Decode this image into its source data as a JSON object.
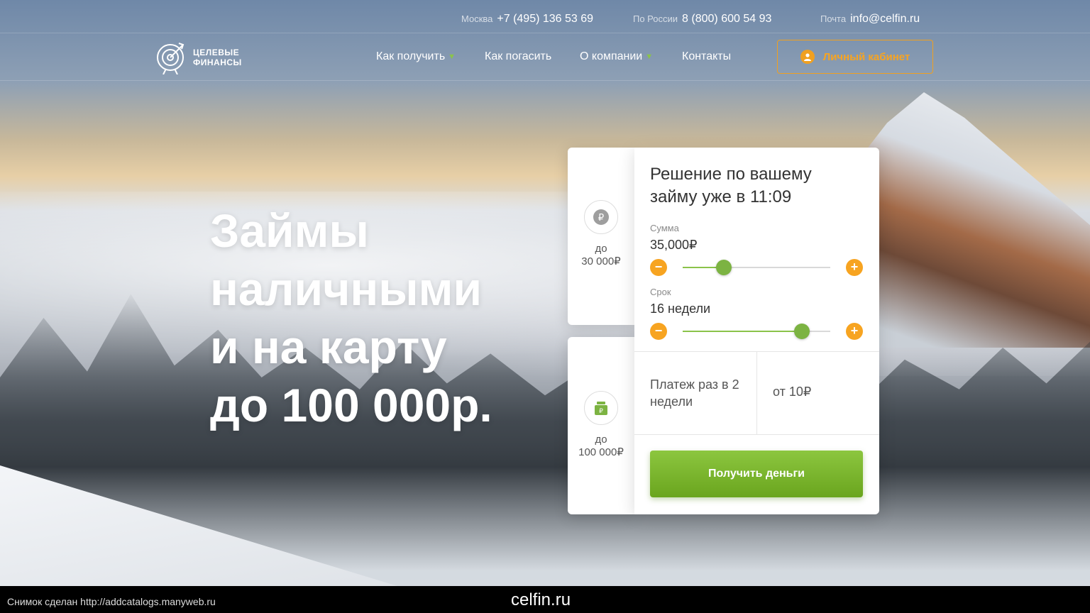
{
  "topbar": {
    "moscow_label": "Москва",
    "moscow_phone": "+7 (495) 136 53 69",
    "russia_label": "По России",
    "russia_phone": "8 (800) 600 54 93",
    "mail_label": "Почта",
    "mail_value": "info@celfin.ru"
  },
  "logo": {
    "line1": "ЦЕЛЕВЫЕ",
    "line2": "ФИНАНСЫ"
  },
  "nav": {
    "items": [
      {
        "label": "Как получить",
        "has_dropdown": true
      },
      {
        "label": "Как погасить",
        "has_dropdown": false
      },
      {
        "label": "О компании",
        "has_dropdown": true
      },
      {
        "label": "Контакты",
        "has_dropdown": false
      }
    ],
    "cabinet_label": "Личный кабинет"
  },
  "hero": {
    "line1": "Займы",
    "line2": "наличными",
    "line3": "и на карту",
    "line4": "до 100 000р."
  },
  "side_cards": [
    {
      "icon": "ruble-coin-icon",
      "line1": "до",
      "line2": "30 000₽"
    },
    {
      "icon": "ruble-wallet-icon",
      "line1": "до",
      "line2": "100 000₽"
    }
  ],
  "calculator": {
    "title": "Решение по вашему займу уже в 11:09",
    "amount_label": "Сумма",
    "amount_value": "35,000₽",
    "amount_level": 0.28,
    "term_label": "Срок",
    "term_value": "16 недели",
    "term_level": 0.81,
    "payment_label": "Платеж раз в 2 недели",
    "payment_value": "от 10₽",
    "submit_label": "Получить деньги"
  },
  "colors": {
    "accent_orange": "#f7a421",
    "accent_green": "#8bc34a"
  },
  "footer": {
    "note": "Снимок сделан http://addcatalogs.manyweb.ru",
    "site": "celfin.ru"
  }
}
